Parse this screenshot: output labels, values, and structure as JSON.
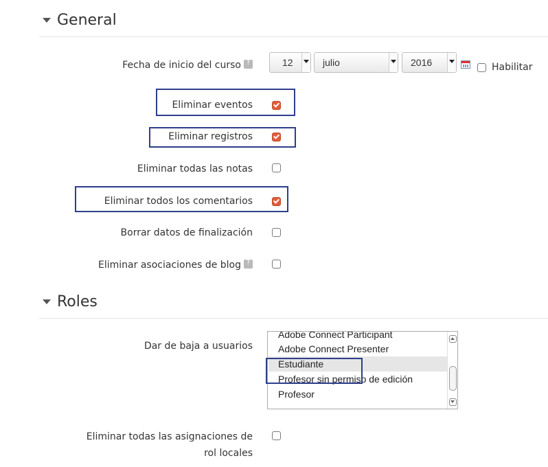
{
  "general": {
    "title": "General",
    "start_date": {
      "label": "Fecha de inicio del curso",
      "day": "12",
      "month": "julio",
      "year": "2016",
      "enable_label": "Habilitar",
      "enable_checked": false
    },
    "options": [
      {
        "label": "Eliminar eventos",
        "checked": true,
        "help": false,
        "highlighted": true
      },
      {
        "label": "Eliminar registros",
        "checked": true,
        "help": false,
        "highlighted": true
      },
      {
        "label": "Eliminar todas las notas",
        "checked": false,
        "help": false,
        "highlighted": false
      },
      {
        "label": "Eliminar todos los comentarios",
        "checked": true,
        "help": false,
        "highlighted": true
      },
      {
        "label": "Borrar datos de finalización",
        "checked": false,
        "help": false,
        "highlighted": false
      },
      {
        "label": "Eliminar asociaciones de blog",
        "checked": false,
        "help": true,
        "highlighted": false
      }
    ]
  },
  "roles": {
    "title": "Roles",
    "unenrol_label": "Dar de baja a usuarios",
    "role_options": [
      {
        "label": "Adobe Connect Participant",
        "selected": false
      },
      {
        "label": "Adobe Connect Presenter",
        "selected": false
      },
      {
        "label": "Estudiante",
        "selected": true
      },
      {
        "label": "Profesor sin permiso de edición",
        "selected": false
      },
      {
        "label": "Profesor",
        "selected": false
      }
    ],
    "local_roles": {
      "label_line1": "Eliminar todas las asignaciones de",
      "label_line2": "rol locales",
      "checked": false
    }
  },
  "colors": {
    "highlight_box": "#2c3e8c",
    "checkbox_checked": "#e25c3a"
  }
}
